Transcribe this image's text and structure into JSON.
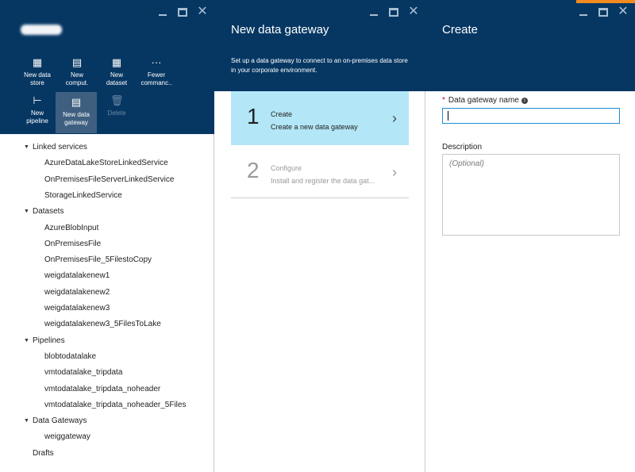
{
  "blade1": {
    "commands": [
      {
        "icon": "new-data-store-icon",
        "label": "New data\nstore",
        "active": false,
        "disabled": false
      },
      {
        "icon": "new-compute-icon",
        "label": "New\ncomput.",
        "active": false,
        "disabled": false
      },
      {
        "icon": "new-dataset-icon",
        "label": "New\ndataset",
        "active": false,
        "disabled": false
      },
      {
        "icon": "more-icon",
        "label": "Fewer\ncommanc..",
        "active": false,
        "disabled": false
      },
      {
        "icon": "new-pipeline-icon",
        "label": "New\npipeline",
        "active": false,
        "disabled": false
      },
      {
        "icon": "new-data-gateway-icon",
        "label": "New data\ngateway",
        "active": true,
        "disabled": false
      },
      {
        "icon": "delete-icon",
        "label": "Delete",
        "active": false,
        "disabled": true
      }
    ],
    "tree": [
      {
        "type": "category",
        "label": "Linked services"
      },
      {
        "type": "leaf",
        "label": "AzureDataLakeStoreLinkedService"
      },
      {
        "type": "leaf",
        "label": "OnPremisesFileServerLinkedService"
      },
      {
        "type": "leaf",
        "label": "StorageLinkedService"
      },
      {
        "type": "category",
        "label": "Datasets"
      },
      {
        "type": "leaf",
        "label": "AzureBlobInput"
      },
      {
        "type": "leaf",
        "label": "OnPremisesFile"
      },
      {
        "type": "leaf",
        "label": "OnPremisesFile_5FilestoCopy"
      },
      {
        "type": "leaf",
        "label": "weigdatalakenew1"
      },
      {
        "type": "leaf",
        "label": "weigdatalakenew2"
      },
      {
        "type": "leaf",
        "label": "weigdatalakenew3"
      },
      {
        "type": "leaf",
        "label": "weigdatalakenew3_5FilesToLake"
      },
      {
        "type": "category",
        "label": "Pipelines"
      },
      {
        "type": "leaf",
        "label": "blobtodatalake"
      },
      {
        "type": "leaf",
        "label": "vmtodatalake_tripdata"
      },
      {
        "type": "leaf",
        "label": "vmtodatalake_tripdata_noheader"
      },
      {
        "type": "leaf",
        "label": "vmtodatalake_tripdata_noheader_5Files"
      },
      {
        "type": "category",
        "label": "Data Gateways"
      },
      {
        "type": "leaf",
        "label": "weiggateway"
      },
      {
        "type": "plain",
        "label": "Drafts"
      }
    ]
  },
  "blade2": {
    "title": "New data gateway",
    "description": "Set up a data gateway to connect to an on-premises data store in your corporate environment.",
    "steps": [
      {
        "number": "1",
        "title": "Create",
        "subtitle": "Create a new data gateway",
        "active": true
      },
      {
        "number": "2",
        "title": "Configure",
        "subtitle": "Install and register the data gat...",
        "active": false
      }
    ]
  },
  "blade3": {
    "title": "Create",
    "name_label": "Data gateway name",
    "required_mark": "*",
    "name_value": "",
    "description_label": "Description",
    "description_placeholder": "(Optional)"
  },
  "colors": {
    "header_bg": "#063763",
    "active_step_bg": "#b3e6f7",
    "active_cmd_bg": "#3e5f80",
    "focus_border": "#1c8dd6",
    "accent_orange": "#f38a1f"
  }
}
